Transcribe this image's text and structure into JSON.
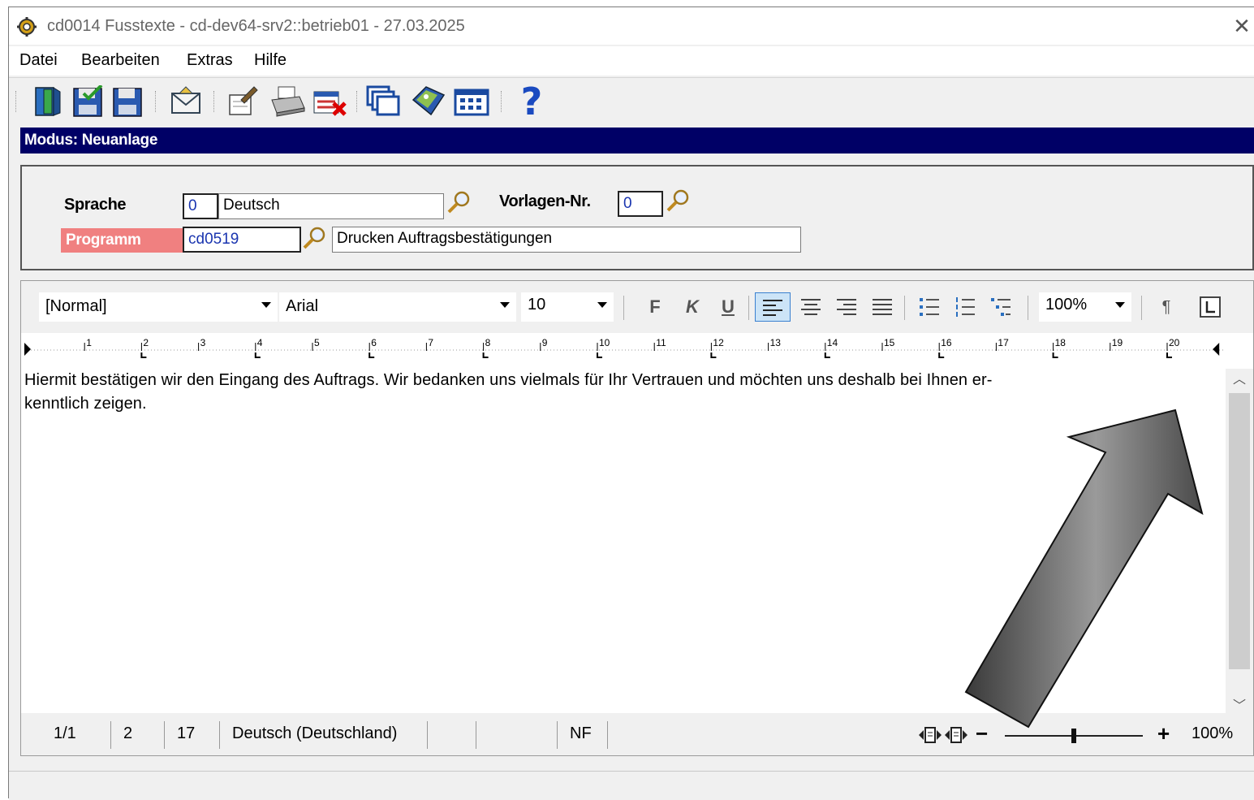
{
  "window": {
    "title": "cd0014 Fusstexte - cd-dev64-srv2::betrieb01 - 27.03.2025",
    "close_glyph": "✕"
  },
  "menu": {
    "items": [
      {
        "label": "Datei"
      },
      {
        "label": "Bearbeiten"
      },
      {
        "label": "Extras"
      },
      {
        "label": "Hilfe"
      }
    ]
  },
  "toolbar": {
    "buttons": [
      {
        "icon": "exit-door-icon"
      },
      {
        "icon": "save-check-icon"
      },
      {
        "icon": "save-icon"
      },
      {
        "icon": "mail-icon"
      },
      {
        "icon": "edit-note-icon"
      },
      {
        "icon": "printer-icon"
      },
      {
        "icon": "delete-list-icon"
      },
      {
        "icon": "windows-icon"
      },
      {
        "icon": "tag-icon"
      },
      {
        "icon": "table-grid-icon"
      },
      {
        "icon": "help-icon"
      }
    ],
    "help_glyph": "?"
  },
  "mode": {
    "label": "Modus: Neuanlage"
  },
  "form": {
    "sprache_label": "Sprache",
    "sprache_code": "0",
    "sprache_name": "Deutsch",
    "vorlagen_label": "Vorlagen-Nr.",
    "vorlagen_value": "0",
    "programm_label": "Programm",
    "programm_code": "cd0519",
    "programm_name": "Drucken Auftragsbestätigungen"
  },
  "editor": {
    "style": "[Normal]",
    "font": "Arial",
    "size": "10",
    "bold": "F",
    "italic": "K",
    "underline": "U",
    "zoom": "100%",
    "pilcrow": "¶",
    "ruler_numbers": [
      "1",
      "2",
      "3",
      "4",
      "5",
      "6",
      "7",
      "8",
      "9",
      "10",
      "11",
      "12",
      "13",
      "14",
      "15",
      "16",
      "17",
      "18",
      "19",
      "20"
    ],
    "content_line1": "Hiermit bestätigen wir den Eingang des Auftrags. Wir bedanken uns vielmals für Ihr Vertrauen und möchten uns deshalb bei Ihnen er-",
    "content_line2": "kenntlich zeigen."
  },
  "status": {
    "page": "1/1",
    "line": "2",
    "col": "17",
    "language": "Deutsch (Deutschland)",
    "mode": "NF",
    "zoom_minus": "−",
    "zoom_plus": "+",
    "zoom": "100%",
    "zoom_level": 0.5
  },
  "colors": {
    "mode_bar": "#000066",
    "programm_label_bg": "#f08080",
    "field_text_blue": "#1a35b0",
    "active_button": "#cce4f7"
  }
}
